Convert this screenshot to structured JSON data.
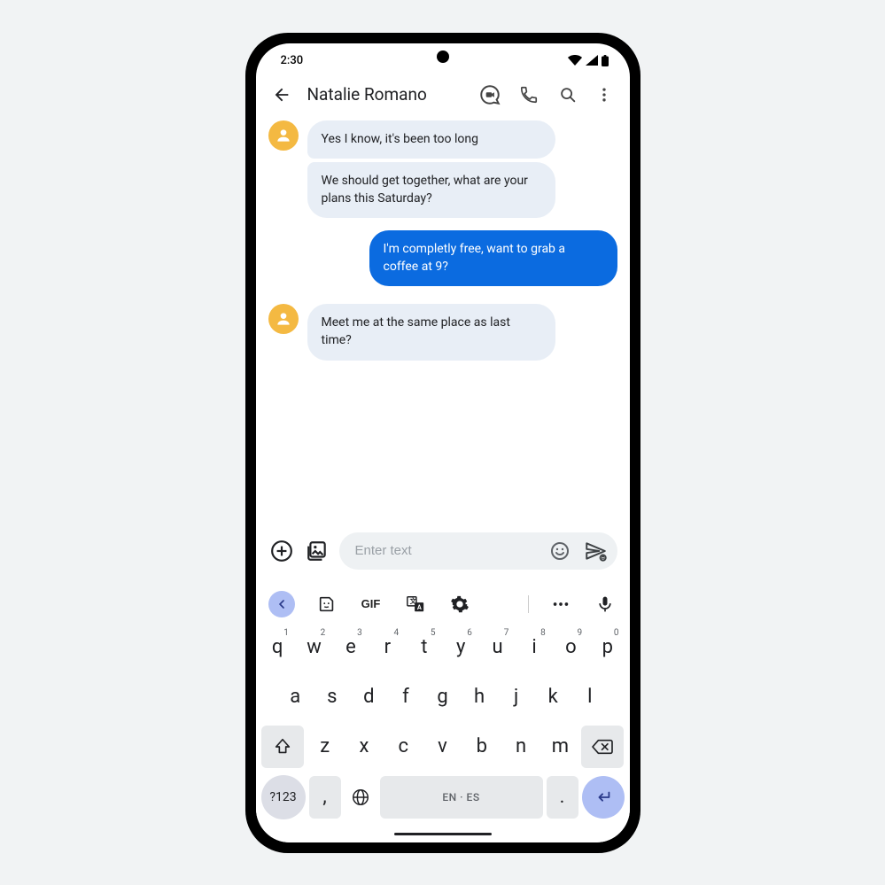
{
  "status_bar": {
    "time": "2:30"
  },
  "header": {
    "contact_name": "Natalie Romano"
  },
  "messages": [
    {
      "from": "in",
      "text": "Yes I know, it's been too long"
    },
    {
      "from": "in",
      "text": "We should get together, what are your plans this Saturday?"
    },
    {
      "from": "out",
      "text": "I'm completly free, want to grab a coffee at 9?"
    },
    {
      "from": "in",
      "text": "Meet me at the same place as last time?"
    }
  ],
  "composer": {
    "placeholder": "Enter text"
  },
  "keyboard": {
    "toolbar": {
      "gif_label": "GIF"
    },
    "row1": [
      {
        "k": "q",
        "s": "1"
      },
      {
        "k": "w",
        "s": "2"
      },
      {
        "k": "e",
        "s": "3"
      },
      {
        "k": "r",
        "s": "4"
      },
      {
        "k": "t",
        "s": "5"
      },
      {
        "k": "y",
        "s": "6"
      },
      {
        "k": "u",
        "s": "7"
      },
      {
        "k": "i",
        "s": "8"
      },
      {
        "k": "o",
        "s": "9"
      },
      {
        "k": "p",
        "s": "0"
      }
    ],
    "row2": [
      "a",
      "s",
      "d",
      "f",
      "g",
      "h",
      "j",
      "k",
      "l"
    ],
    "row3": [
      "z",
      "x",
      "c",
      "v",
      "b",
      "n",
      "m"
    ],
    "sym_label": "?123",
    "comma": ",",
    "period": ".",
    "space_label": "EN · ES"
  }
}
